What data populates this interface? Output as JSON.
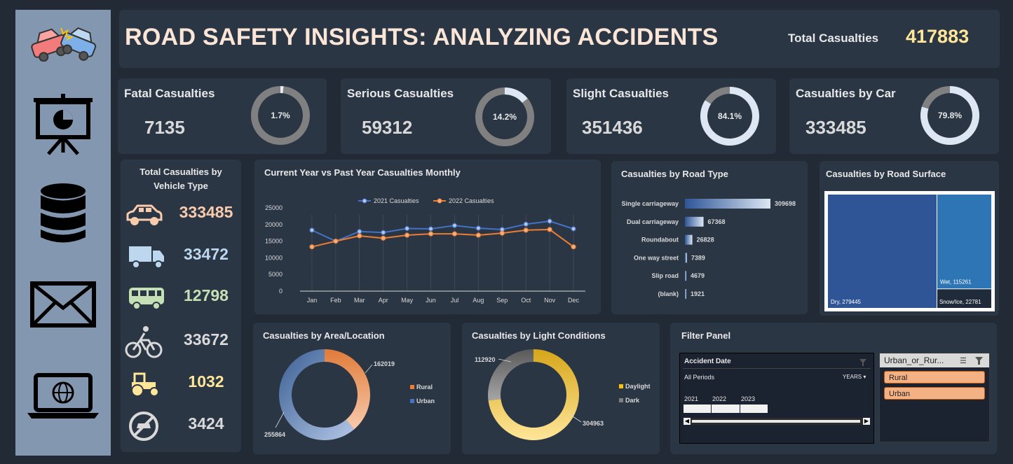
{
  "header": {
    "title": "ROAD SAFETY INSIGHTS: ANALYZING ACCIDENTS",
    "total_label": "Total Casualties",
    "total_value": "417883"
  },
  "sidebar": {
    "icons": [
      "car-crash-icon",
      "presentation-chart-icon",
      "database-icon",
      "mail-icon",
      "laptop-globe-icon"
    ]
  },
  "kpis": [
    {
      "label": "Fatal Casualties",
      "value": "7135",
      "pct_text": "1.7%",
      "pct": 0.017
    },
    {
      "label": "Serious Casualties",
      "value": "59312",
      "pct_text": "14.2%",
      "pct": 0.142
    },
    {
      "label": "Slight Casualties",
      "value": "351436",
      "pct_text": "84.1%",
      "pct": 0.841
    },
    {
      "label": "Casualties by Car",
      "value": "333485",
      "pct_text": "79.8%",
      "pct": 0.798
    }
  ],
  "vehicle_type": {
    "title": "Total Casualties by Vehicle Type",
    "items": [
      {
        "icon": "car-icon",
        "value": "333485",
        "color": "#f8cbad"
      },
      {
        "icon": "truck-icon",
        "value": "33472",
        "color": "#bdd7ee"
      },
      {
        "icon": "bus-icon",
        "value": "12798",
        "color": "#c5e0b4"
      },
      {
        "icon": "bicycle-icon",
        "value": "33672",
        "color": "#d9d9d9"
      },
      {
        "icon": "tractor-icon",
        "value": "1032",
        "color": "#ffe699"
      },
      {
        "icon": "no-vehicle-icon",
        "value": "3424",
        "color": "#d9d9d9"
      }
    ]
  },
  "filter_panel": {
    "title": "Filter Panel",
    "date_slicer": {
      "header": "Accident Date",
      "periods": "All Periods",
      "level": "YEARS",
      "years": [
        "2021",
        "2022",
        "2023"
      ]
    },
    "area_slicer": {
      "header": "Urban_or_Rur...",
      "options": [
        "Rural",
        "Urban"
      ]
    }
  },
  "colors": {
    "sidebar": "#8497b0",
    "card": "#2b3645",
    "background": "#222a35",
    "accent_gold": "#ffe699",
    "title": "#fbe5d6"
  },
  "chart_data": [
    {
      "type": "line",
      "title": "Current Year vs Past Year Casualties Monthly",
      "categories": [
        "Jan",
        "Feb",
        "Mar",
        "Apr",
        "May",
        "Jun",
        "Jul",
        "Aug",
        "Sep",
        "Oct",
        "Nov",
        "Dec"
      ],
      "series": [
        {
          "name": "2021 Casualties",
          "color": "#4472c4",
          "values": [
            18300,
            15000,
            17900,
            17600,
            18800,
            18700,
            19700,
            18900,
            18500,
            20100,
            21000,
            18700
          ]
        },
        {
          "name": "2022 Casualties",
          "color": "#ed7d31",
          "values": [
            13300,
            15000,
            16600,
            15900,
            16800,
            17200,
            17200,
            16800,
            17400,
            18300,
            18500,
            13300
          ]
        }
      ],
      "yticks": [
        "0",
        "5000",
        "10000",
        "15000",
        "20000",
        "25000"
      ],
      "ylim": [
        0,
        25000
      ],
      "legend": "top"
    },
    {
      "type": "bar",
      "title": "Casualties by Road Type",
      "categories": [
        "Single carriageway",
        "Dual carriageway",
        "Roundabout",
        "One way street",
        "Slip road",
        "(blank)"
      ],
      "values": [
        309698,
        67368,
        26828,
        7389,
        4679,
        1921
      ],
      "labels": [
        "309698",
        "67368",
        "26828",
        "7389",
        "4679",
        "1921"
      ]
    },
    {
      "type": "heatmap",
      "title": "Casualties by Road Surface",
      "items": [
        {
          "label": "Dry, 279445",
          "value": 279445
        },
        {
          "label": "Wet, 115261",
          "value": 115261
        },
        {
          "label": "Snow/Ice, 22781",
          "value": 22781
        }
      ]
    },
    {
      "type": "pie",
      "title": "Casualties by Area/Location",
      "slices": [
        {
          "name": "Rural",
          "value": 162019,
          "label": "162019",
          "color": "#ed7d31"
        },
        {
          "name": "Urban",
          "value": 255864,
          "label": "255864",
          "color": "#4472c4"
        }
      ]
    },
    {
      "type": "pie",
      "title": "Casualties by Light Conditions",
      "slices": [
        {
          "name": "Daylight",
          "value": 304963,
          "label": "304963",
          "color": "#ffc000"
        },
        {
          "name": "Dark",
          "value": 112920,
          "label": "112920",
          "color": "#7f7f7f"
        }
      ]
    }
  ]
}
